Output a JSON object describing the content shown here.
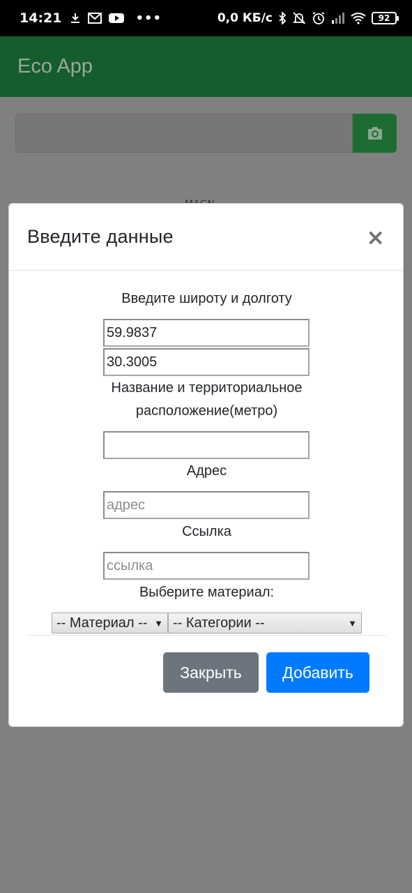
{
  "status_bar": {
    "time": "14:21",
    "speed": "0,0 КБ/с",
    "battery": "92",
    "icons": [
      "download-icon",
      "gmail-icon",
      "youtube-icon",
      "more-dots-icon",
      "bluetooth-icon",
      "mute-icon",
      "alarm-icon",
      "signal-icon",
      "wifi-icon",
      "battery-icon"
    ]
  },
  "app_bar": {
    "title": "Eco App"
  },
  "background": {
    "partial_text": "MAGN"
  },
  "modal": {
    "title": "Введите данные",
    "close_symbol": "×",
    "lat_lon_label": "Введите широту и долготу",
    "latitude_value": "59.9837",
    "longitude_value": "30.3005",
    "name_label_line1": "Название и территориальное",
    "name_label_line2": "расположение(метро)",
    "name_value": "",
    "address_label": "Адрес",
    "address_placeholder": "адрес",
    "link_label": "Ссылка",
    "link_placeholder": "ссылка",
    "material_label": "Выберите материал:",
    "material_select": "-- Материал --",
    "category_select": "-- Категории --",
    "close_button": "Закрыть",
    "add_button": "Добавить"
  },
  "colors": {
    "overlay_gray": "#808080",
    "appbar_green": "#155d2e",
    "primary_blue": "#007bff",
    "secondary_gray": "#6c757d"
  }
}
